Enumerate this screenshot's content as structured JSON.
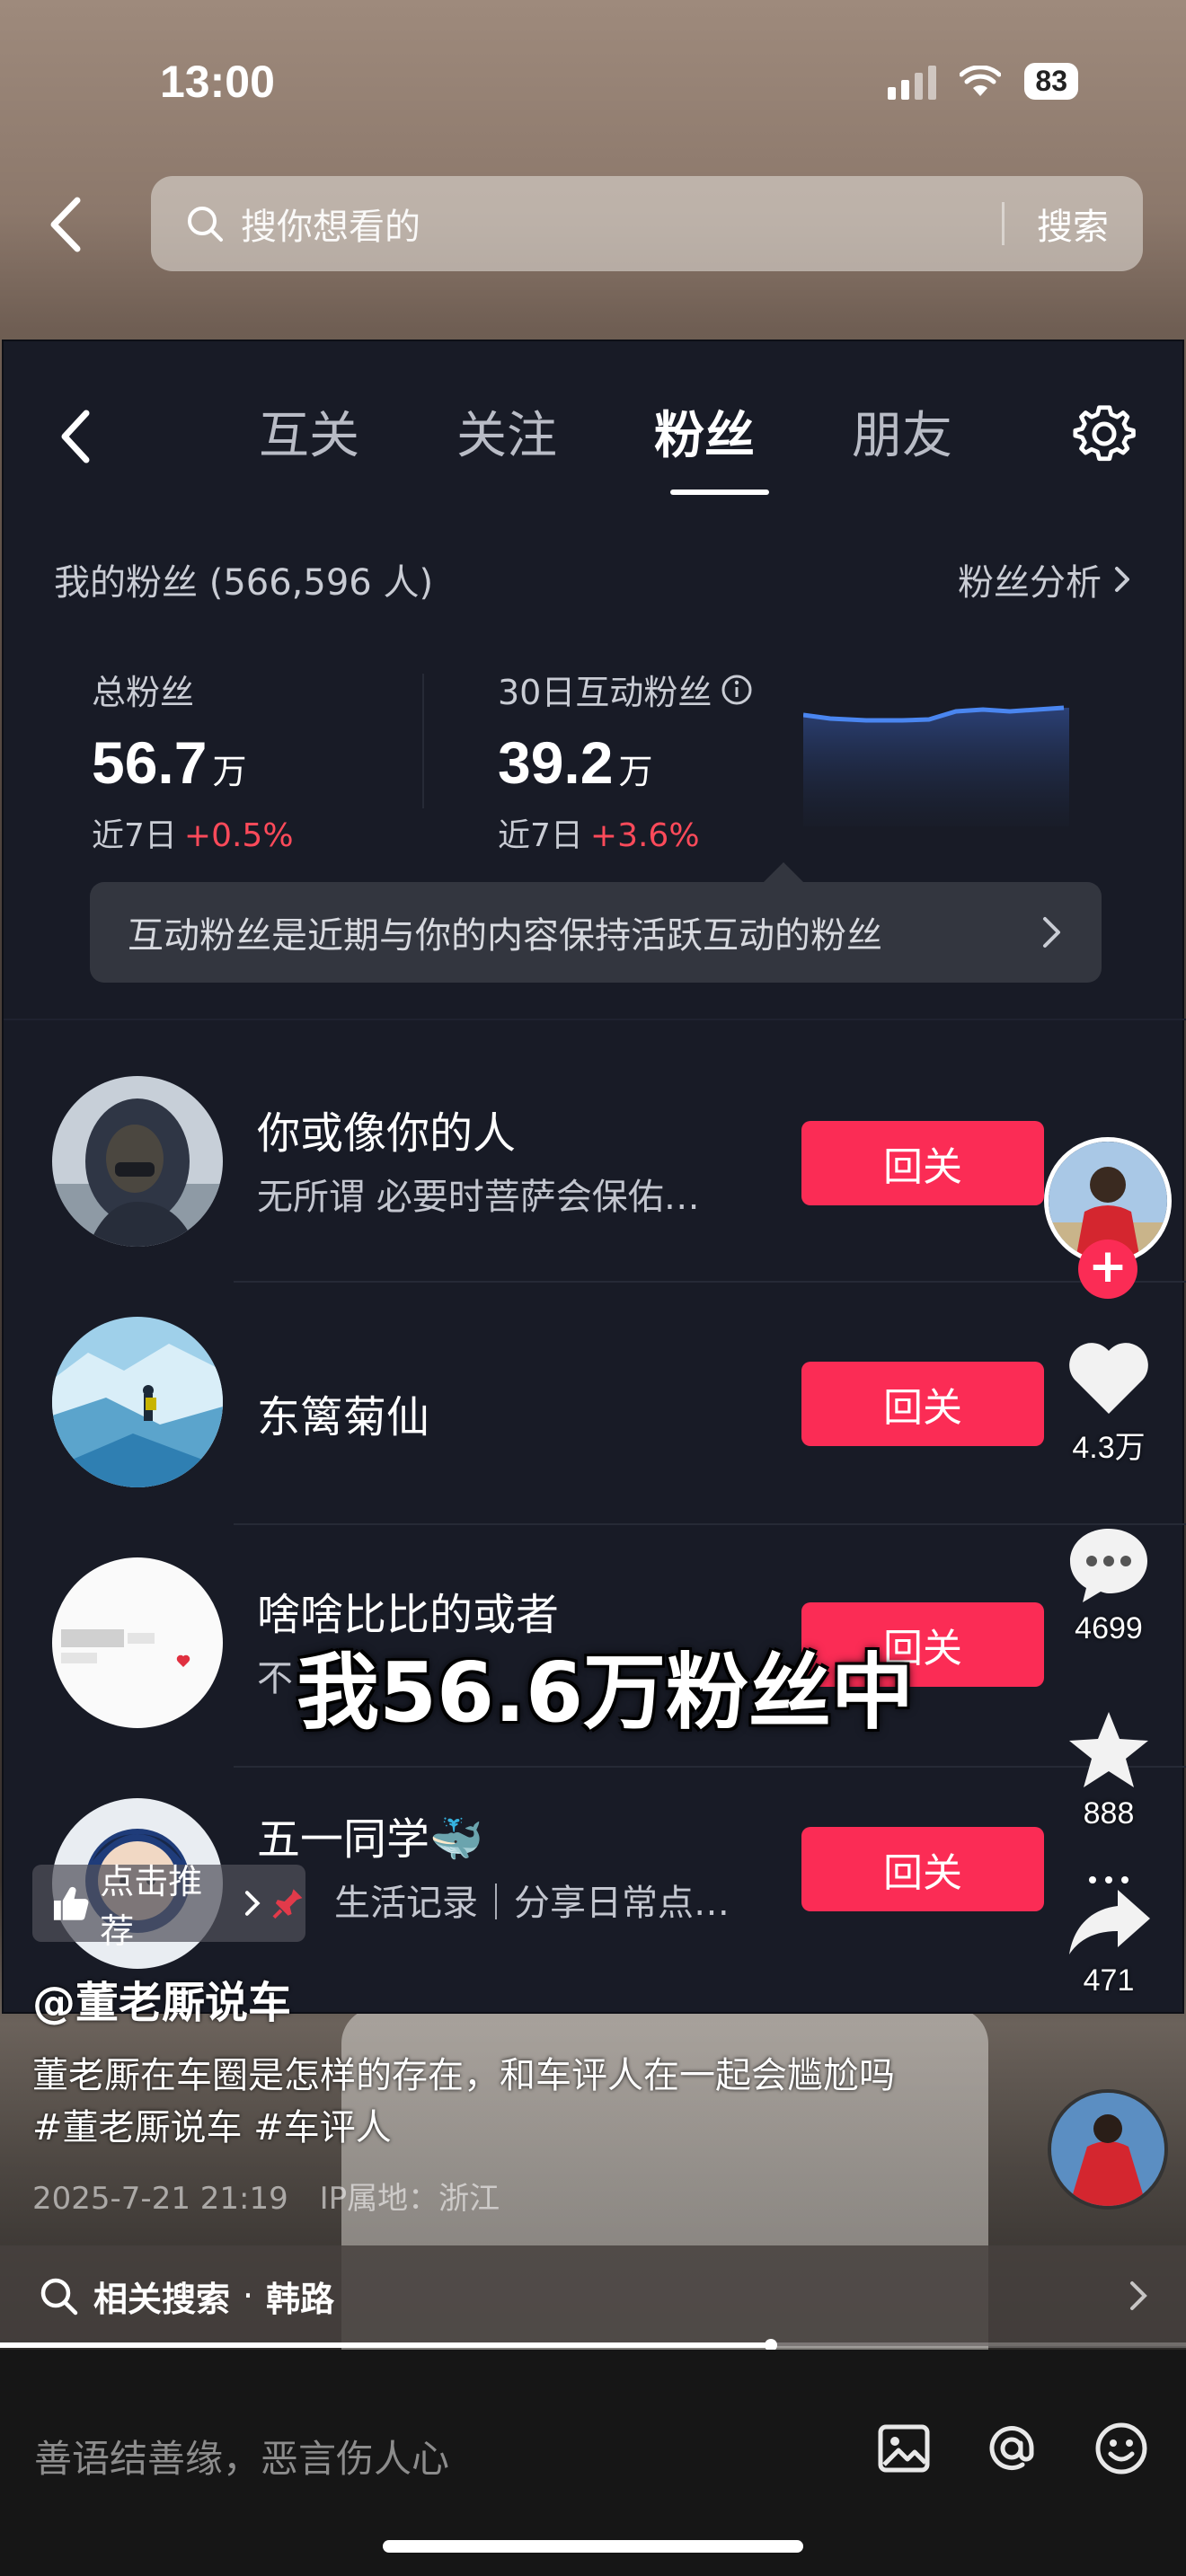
{
  "status_bar": {
    "time": "13:00",
    "battery": "83"
  },
  "search": {
    "placeholder": "搜你想看的",
    "button": "搜索"
  },
  "panel": {
    "tabs": [
      {
        "label": "互关"
      },
      {
        "label": "关注"
      },
      {
        "label": "粉丝"
      },
      {
        "label": "朋友"
      }
    ],
    "active_tab": "粉丝",
    "fans_title": "我的粉丝 (566,596 人)",
    "fans_analysis": "粉丝分析",
    "total": {
      "label": "总粉丝",
      "value": "56.7",
      "unit": "万",
      "week_label": "近7日",
      "week_change": "+0.5%"
    },
    "active": {
      "label": "30日互动粉丝",
      "value": "39.2",
      "unit": "万",
      "week_label": "近7日",
      "week_change": "+3.6%"
    },
    "tooltip": "互动粉丝是近期与你的内容保持活跃互动的粉丝",
    "fans": [
      {
        "name": "你或像你的人",
        "desc": "无所谓 必要时菩萨会保佑…",
        "button": "回关"
      },
      {
        "name": "东篱菊仙",
        "desc": "",
        "button": "回关"
      },
      {
        "name": "啥啥比比的或者",
        "desc": "不",
        "button": "回关"
      },
      {
        "name": "五一同学🐳",
        "desc": "生活记录｜分享日常点…",
        "button": "回关"
      }
    ]
  },
  "overlay_caption": "我56.6万粉丝中",
  "recommend": "点击推荐",
  "side": {
    "likes": "4.3万",
    "comments": "4699",
    "favorites": "888",
    "shares": "471"
  },
  "post": {
    "author": "@董老厮说车",
    "description": "董老厮在车圈是怎样的存在，和车评人在一起会尴尬吗 #董老厮说车 #车评人",
    "date": "2025-7-21 21:19",
    "ip": "IP属地：浙江"
  },
  "related": {
    "label": "相关搜索",
    "dot": "·",
    "term": "韩路"
  },
  "progress": 0.65,
  "comment": {
    "placeholder": "善语结善缘，恶言伤人心"
  },
  "colors": {
    "accent": "#fb2c55",
    "positive_change": "#ff4a5a",
    "panel_bg": "#181b26"
  }
}
